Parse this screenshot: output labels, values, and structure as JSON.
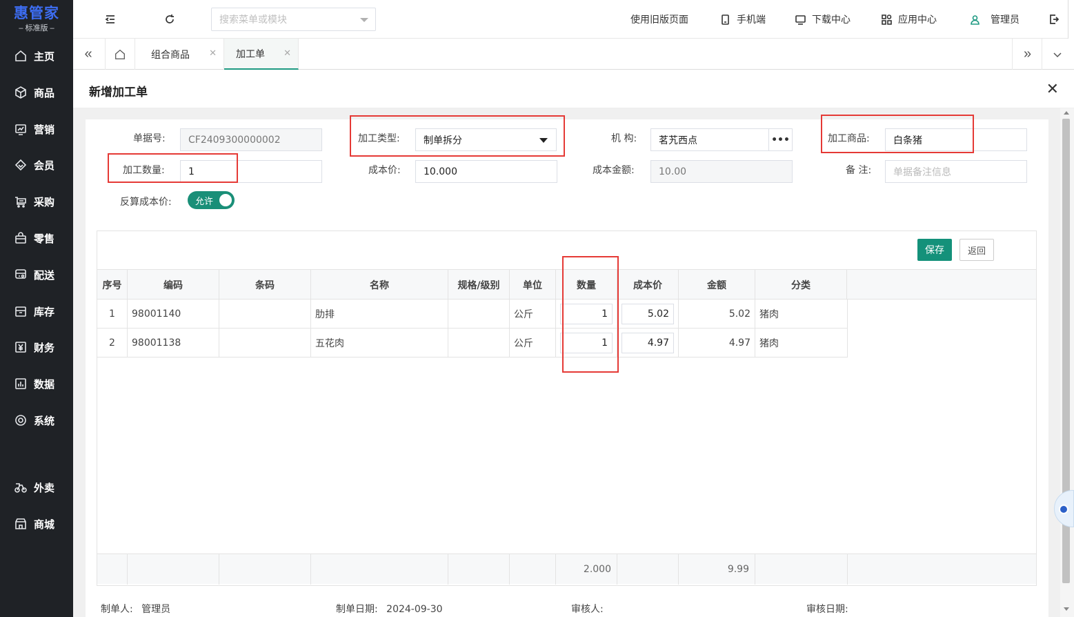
{
  "app": {
    "logo_main": "惠管家",
    "logo_sub": "– 标准版 –"
  },
  "sidebar": {
    "items": [
      {
        "label": "主页",
        "icon": "home-icon"
      },
      {
        "label": "商品",
        "icon": "cube-icon"
      },
      {
        "label": "营销",
        "icon": "chart-icon"
      },
      {
        "label": "会员",
        "icon": "diamond-icon"
      },
      {
        "label": "采购",
        "icon": "cart-icon"
      },
      {
        "label": "零售",
        "icon": "bag-icon"
      },
      {
        "label": "配送",
        "icon": "truck-icon"
      },
      {
        "label": "库存",
        "icon": "box-icon"
      },
      {
        "label": "财务",
        "icon": "yen-icon"
      },
      {
        "label": "数据",
        "icon": "bar-chart-icon"
      },
      {
        "label": "系统",
        "icon": "target-icon"
      },
      {
        "label": "外卖",
        "icon": "bike-icon"
      },
      {
        "label": "商城",
        "icon": "store-icon"
      }
    ]
  },
  "header": {
    "search_placeholder": "搜索菜单或模块",
    "links": {
      "old_version": "使用旧版页面",
      "mobile": "手机端",
      "download": "下载中心",
      "apps": "应用中心",
      "user": "管理员"
    }
  },
  "tabs": [
    {
      "label": "组合商品"
    },
    {
      "label": "加工单"
    }
  ],
  "panel": {
    "title": "新增加工单"
  },
  "form": {
    "doc_no_label": "单据号:",
    "doc_no_value": "CF2409300000002",
    "process_type_label": "加工类型:",
    "process_type_value": "制单拆分",
    "org_label": "机  构:",
    "org_value": "茗艽西点",
    "product_label": "加工商品:",
    "product_value": "白条猪",
    "qty_label": "加工数量:",
    "qty_value": "1",
    "cost_price_label": "成本价:",
    "cost_price_value": "10.000",
    "cost_amount_label": "成本金额:",
    "cost_amount_value": "10.00",
    "remark_label": "备  注:",
    "remark_placeholder": "单据备注信息",
    "reverse_cost_label": "反算成本价:",
    "reverse_cost_toggle": "允许"
  },
  "actions": {
    "save": "保存",
    "back": "返回"
  },
  "table": {
    "columns": [
      "序号",
      "编码",
      "条码",
      "名称",
      "规格/级别",
      "单位",
      "数量",
      "成本价",
      "金额",
      "分类"
    ],
    "rows": [
      {
        "idx": "1",
        "code": "98001140",
        "barcode": "",
        "name": "肋排",
        "spec": "",
        "unit": "公斤",
        "qty": "1",
        "cost": "5.02",
        "amount": "5.02",
        "category": "猪肉"
      },
      {
        "idx": "2",
        "code": "98001138",
        "barcode": "",
        "name": "五花肉",
        "spec": "",
        "unit": "公斤",
        "qty": "1",
        "cost": "4.97",
        "amount": "4.97",
        "category": "猪肉"
      }
    ],
    "totals": {
      "qty": "2.000",
      "amount": "9.99"
    }
  },
  "footer": {
    "creator_label": "制单人:",
    "creator_value": "管理员",
    "date_label": "制单日期:",
    "date_value": "2024-09-30",
    "reviewer_label": "审核人:",
    "review_date_label": "审核日期:"
  },
  "colors": {
    "accent": "#14917a",
    "sidebar_bg": "#1f2226",
    "highlight": "#e53935",
    "logo": "#3d6df2"
  }
}
